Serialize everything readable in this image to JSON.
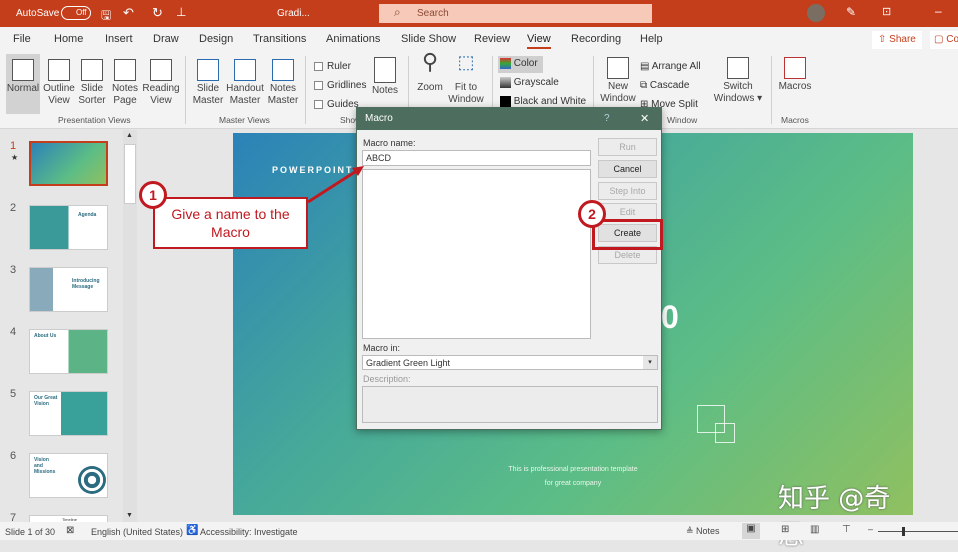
{
  "titlebar": {
    "autosave": "AutoSave",
    "toggle": "Off",
    "doc_title": "Gradi...",
    "search_placeholder": "Search"
  },
  "tabs": [
    "File",
    "Home",
    "Insert",
    "Draw",
    "Design",
    "Transitions",
    "Animations",
    "Slide Show",
    "Review",
    "View",
    "Recording",
    "Help"
  ],
  "active_tab": "View",
  "share": "Share",
  "comments": "Co",
  "ribbon": {
    "presentation_views": {
      "label": "Presentation Views",
      "items": [
        "Normal",
        "Outline View",
        "Slide Sorter",
        "Notes Page",
        "Reading View"
      ]
    },
    "master_views": {
      "label": "Master Views",
      "items": [
        "Slide Master",
        "Handout Master",
        "Notes Master"
      ]
    },
    "show": {
      "label": "Show",
      "checks": [
        "Ruler",
        "Gridlines",
        "Guides"
      ],
      "notes": "Notes"
    },
    "zoom": {
      "items": [
        "Zoom",
        "Fit to Window"
      ]
    },
    "color": {
      "items": [
        "Color",
        "Grayscale",
        "Black and White"
      ]
    },
    "window": {
      "label": "Window",
      "new_window": "New Window",
      "items": [
        "Arrange All",
        "Cascade",
        "Move Split"
      ],
      "switch": "Switch Windows"
    },
    "macros": {
      "label": "Macros",
      "item": "Macros"
    }
  },
  "slides": [
    {
      "n": "1"
    },
    {
      "n": "2",
      "title": "Agenda"
    },
    {
      "n": "3",
      "title": "Introducing Message"
    },
    {
      "n": "4",
      "title": "About Us"
    },
    {
      "n": "5",
      "title": "Our Great Vision"
    },
    {
      "n": "6",
      "title": "Vision and Missions"
    },
    {
      "n": "7",
      "title": "Timeline"
    }
  ],
  "slide": {
    "brand": "POWERPOINT",
    "partial_text": "0",
    "footer1": "This is professional presentation template",
    "footer2": "for great company"
  },
  "dialog": {
    "title": "Macro",
    "help": "?",
    "close": "✕",
    "name_label": "Macro name:",
    "name_value": "ABCD",
    "macro_in_label": "Macro in:",
    "macro_in_value": "Gradient Green Light",
    "description_label": "Description:",
    "buttons": {
      "run": "Run",
      "cancel": "Cancel",
      "step_into": "Step Into",
      "edit": "Edit",
      "create": "Create",
      "delete": "Delete"
    }
  },
  "callouts": {
    "one": {
      "n": "1",
      "text": "Give a name to the Macro"
    },
    "two": {
      "n": "2"
    }
  },
  "watermark": "知乎 @奇思",
  "status": {
    "slide": "Slide 1 of 30",
    "language": "English (United States)",
    "accessibility": "Accessibility: Investigate",
    "notes": "Notes"
  },
  "colors": {
    "accent": "#c43e1c",
    "dialog_title": "#4d6e5e",
    "callout": "#c0191f"
  }
}
